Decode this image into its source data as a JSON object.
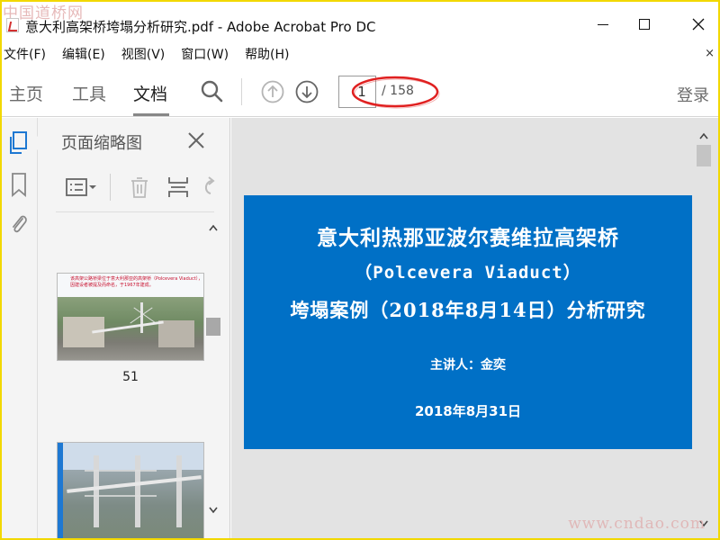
{
  "window": {
    "title": "意大利高架桥垮塌分析研究.pdf - Adobe Acrobat Pro DC",
    "watermark_top": "中国道桥网",
    "watermark_bottom": "www.cndao.com"
  },
  "menubar": {
    "items": [
      "文件(F)",
      "编辑(E)",
      "视图(V)",
      "窗口(W)",
      "帮助(H)"
    ],
    "close": "×"
  },
  "toolbar": {
    "tabs": [
      "主页",
      "工具",
      "文档"
    ],
    "active_tab": "文档",
    "page_current": "1",
    "page_total": "/ 158",
    "login": "登录"
  },
  "panel": {
    "title": "页面缩略图",
    "thumbnails": [
      {
        "label": "51",
        "caption": "该高架公路桥梁位于意大利那亚的高架桥（Polcevera Viaduct），因建设者被提及而命名，于1967年建成。"
      },
      {
        "label": ""
      }
    ]
  },
  "document": {
    "slide": {
      "title": "意大利热那亚波尔赛维拉高架桥",
      "subtitle": "（Polcevera Viaduct）",
      "title2": "垮塌案例（2018年8月14日）分析研究",
      "speaker": "主讲人：金奕",
      "date": "2018年8月31日",
      "background": "#0070c6"
    }
  },
  "colors": {
    "accent_annotation": "#e02020",
    "frame": "#f2d800"
  }
}
